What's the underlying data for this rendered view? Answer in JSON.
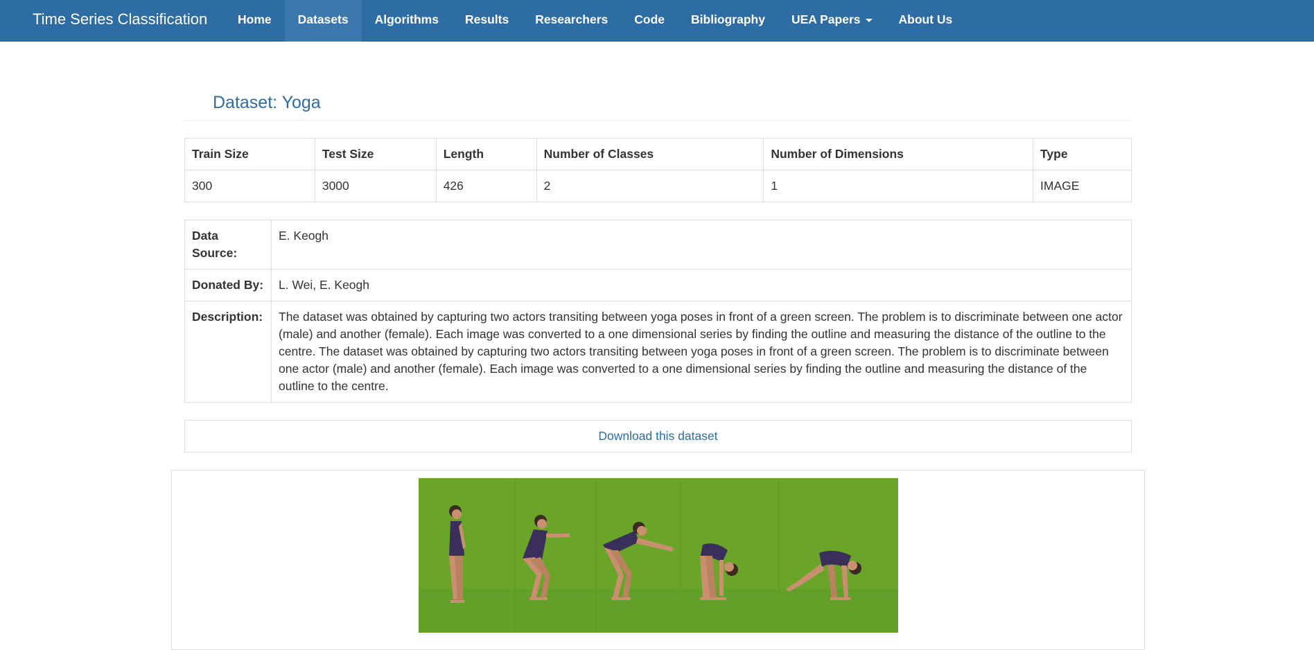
{
  "navbar": {
    "brand": "Time Series Classification",
    "items": [
      {
        "label": "Home"
      },
      {
        "label": "Datasets",
        "active": true
      },
      {
        "label": "Algorithms"
      },
      {
        "label": "Results"
      },
      {
        "label": "Researchers"
      },
      {
        "label": "Code"
      },
      {
        "label": "Bibliography"
      },
      {
        "label": "UEA Papers",
        "dropdown": true
      },
      {
        "label": "About Us"
      }
    ]
  },
  "page": {
    "title": "Dataset: Yoga"
  },
  "stats": {
    "headers": [
      "Train Size",
      "Test Size",
      "Length",
      "Number of Classes",
      "Number of Dimensions",
      "Type"
    ],
    "values": [
      "300",
      "3000",
      "426",
      "2",
      "1",
      "IMAGE"
    ]
  },
  "info": {
    "source_label": "Data Source:",
    "source_value": "E. Keogh",
    "donated_label": "Donated By:",
    "donated_value": "L. Wei, E. Keogh",
    "description_label": "Description:",
    "description_value": "The dataset was obtained by capturing two actors transiting between yoga poses in front of a green screen. The problem is to discriminate between one actor (male) and another (female). Each image was converted to a one dimensional series by finding the outline and measuring the distance of the outline to the centre. The dataset was obtained by capturing two actors transiting between yoga poses in front of a green screen. The problem is to discriminate between one actor (male) and another (female). Each image was converted to a one dimensional series by finding the outline and measuring the distance of the outline to the centre."
  },
  "download": {
    "label": "Download this dataset"
  },
  "colors": {
    "navbar": "#2e6da4",
    "link": "#2e6da4",
    "green_screen": "#6aa52a",
    "leotard": "#3a2f5a",
    "skin": "#c8906e"
  }
}
